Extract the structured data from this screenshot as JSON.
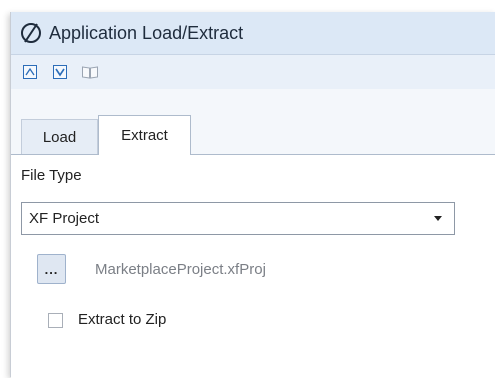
{
  "window": {
    "title": "Application Load/Extract",
    "logo_icon": "onestream-logo-icon"
  },
  "toolbar": {
    "buttons": [
      {
        "icon": "load-document-icon"
      },
      {
        "icon": "extract-document-icon"
      },
      {
        "icon": "open-book-icon"
      }
    ]
  },
  "tabs": [
    {
      "label": "Load",
      "selected": false
    },
    {
      "label": "Extract",
      "selected": true
    }
  ],
  "extract_panel": {
    "file_type_label": "File Type",
    "file_type_value": "XF Project",
    "browse_button_label": "...",
    "file_path": "MarketplaceProject.xfProj",
    "extract_to_zip_label": "Extract to Zip",
    "extract_to_zip_checked": false
  },
  "colors": {
    "titlebar_bg": "#dce8f6",
    "toolbar_bg": "#e9f0f9",
    "accent_blue": "#2b6cb8"
  }
}
